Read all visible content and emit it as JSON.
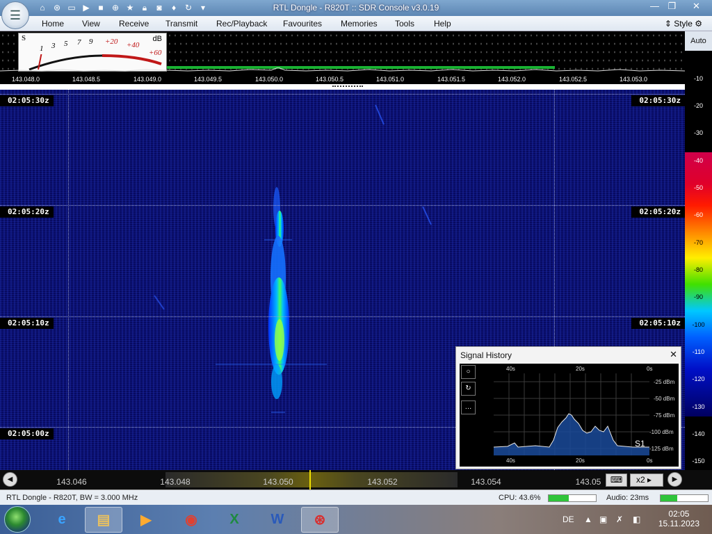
{
  "window": {
    "title": "RTL Dongle - R820T :: SDR Console v3.0.19",
    "controls": [
      "minimize-icon",
      "restore-icon",
      "close-icon"
    ]
  },
  "quick_access": [
    "home-icon",
    "lifebuoy-icon",
    "folder-icon",
    "play-icon",
    "stop-icon",
    "plus-icon",
    "star-icon",
    "lock-icon",
    "camera-icon",
    "drop-icon",
    "refresh-icon",
    "dropdown-icon"
  ],
  "menu": {
    "items": [
      "Home",
      "View",
      "Receive",
      "Transmit",
      "Rec/Playback",
      "Favourites",
      "Memories",
      "Tools",
      "Help"
    ],
    "style_label": "Style"
  },
  "smeter": {
    "s_label": "S",
    "db_label": "dB",
    "scale": [
      "1",
      "3",
      "5",
      "7",
      "9",
      "+20",
      "+40",
      "+60"
    ]
  },
  "ruler": {
    "ticks": [
      "143.048.0",
      "143.048.5",
      "143.049.0",
      "143.049.5",
      "143.050.0",
      "143.050.5",
      "143.051.0",
      "143.051.5",
      "143.052.0",
      "143.052.5",
      "143.053.0"
    ]
  },
  "waterfall": {
    "timestamps": [
      "02:05:30z",
      "02:05:20z",
      "02:05:10z",
      "02:05:00z"
    ]
  },
  "dbscale": {
    "auto_label": "Auto",
    "labels": [
      "-10",
      "-20",
      "-30",
      "-40",
      "-50",
      "-60",
      "-70",
      "-80",
      "-90",
      "-100",
      "-110",
      "-120",
      "-130",
      "-140",
      "-150"
    ]
  },
  "signal_history": {
    "title": "Signal History",
    "close": "✕",
    "time_labels": [
      "40s",
      "20s",
      "0s"
    ],
    "dbm_labels": [
      "-25 dBm",
      "-50 dBm",
      "-75 dBm",
      "-100 dBm",
      "-125 dBm"
    ],
    "s_label": "S1",
    "tool_buttons": [
      "○",
      "↻",
      "…"
    ]
  },
  "bottom_scale": {
    "labels": [
      "143.046",
      "143.048",
      "143.050",
      "143.052",
      "143.054",
      "143.05"
    ],
    "zoom_label": "x2",
    "keyboard_icon": "⌨"
  },
  "status": {
    "device": "RTL Dongle - R820T, BW = 3.000 MHz",
    "cpu": "CPU: 43.6%",
    "cpu_level": 0.43,
    "audio": "Audio: 23ms",
    "audio_level": 0.35
  },
  "taskbar": {
    "apps": [
      "ie-icon",
      "explorer-icon",
      "media-player-icon",
      "chrome-icon",
      "excel-icon",
      "word-icon",
      "sdr-console-icon"
    ],
    "lang": "DE",
    "time": "02:05",
    "date": "15.11.2023"
  }
}
